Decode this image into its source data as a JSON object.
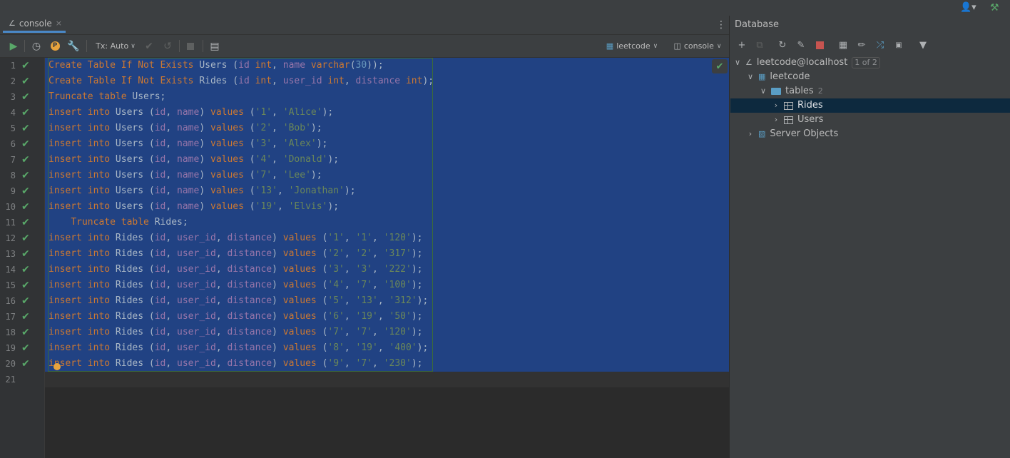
{
  "topbar": {
    "user_icon": "user-icon",
    "build_icon": "hammer-icon"
  },
  "tab": {
    "label": "console",
    "close": "×"
  },
  "toolbar": {
    "tx_label": "Tx: Auto",
    "datasource": "leetcode",
    "session": "console"
  },
  "editor": {
    "line_numbers": [
      "1",
      "2",
      "3",
      "4",
      "5",
      "6",
      "7",
      "8",
      "9",
      "10",
      "11",
      "12",
      "13",
      "14",
      "15",
      "16",
      "17",
      "18",
      "19",
      "20",
      "21"
    ],
    "lines": [
      [
        [
          "k",
          "Create Table If Not Exists "
        ],
        [
          "t",
          "Users ("
        ],
        [
          "f",
          "id"
        ],
        [
          "k",
          " int"
        ],
        [
          "t",
          ", "
        ],
        [
          "f",
          "name"
        ],
        [
          "k",
          " varchar"
        ],
        [
          "t",
          "("
        ],
        [
          "n",
          "30"
        ],
        [
          "t",
          "));"
        ]
      ],
      [
        [
          "k",
          "Create Table If Not Exists "
        ],
        [
          "t",
          "Rides ("
        ],
        [
          "f",
          "id"
        ],
        [
          "k",
          " int"
        ],
        [
          "t",
          ", "
        ],
        [
          "f",
          "user_id"
        ],
        [
          "k",
          " int"
        ],
        [
          "t",
          ", "
        ],
        [
          "f",
          "distance"
        ],
        [
          "k",
          " int"
        ],
        [
          "t",
          ");"
        ]
      ],
      [
        [
          "k",
          "Truncate table "
        ],
        [
          "t",
          "Users;"
        ]
      ],
      [
        [
          "k",
          "insert into "
        ],
        [
          "t",
          "Users ("
        ],
        [
          "f",
          "id"
        ],
        [
          "t",
          ", "
        ],
        [
          "f",
          "name"
        ],
        [
          "t",
          ") "
        ],
        [
          "k",
          "values "
        ],
        [
          "t",
          "("
        ],
        [
          "s",
          "'1'"
        ],
        [
          "t",
          ", "
        ],
        [
          "s",
          "'Alice'"
        ],
        [
          "t",
          ");"
        ]
      ],
      [
        [
          "k",
          "insert into "
        ],
        [
          "t",
          "Users ("
        ],
        [
          "f",
          "id"
        ],
        [
          "t",
          ", "
        ],
        [
          "f",
          "name"
        ],
        [
          "t",
          ") "
        ],
        [
          "k",
          "values "
        ],
        [
          "t",
          "("
        ],
        [
          "s",
          "'2'"
        ],
        [
          "t",
          ", "
        ],
        [
          "s",
          "'Bob'"
        ],
        [
          "t",
          ");"
        ]
      ],
      [
        [
          "k",
          "insert into "
        ],
        [
          "t",
          "Users ("
        ],
        [
          "f",
          "id"
        ],
        [
          "t",
          ", "
        ],
        [
          "f",
          "name"
        ],
        [
          "t",
          ") "
        ],
        [
          "k",
          "values "
        ],
        [
          "t",
          "("
        ],
        [
          "s",
          "'3'"
        ],
        [
          "t",
          ", "
        ],
        [
          "s",
          "'Alex'"
        ],
        [
          "t",
          ");"
        ]
      ],
      [
        [
          "k",
          "insert into "
        ],
        [
          "t",
          "Users ("
        ],
        [
          "f",
          "id"
        ],
        [
          "t",
          ", "
        ],
        [
          "f",
          "name"
        ],
        [
          "t",
          ") "
        ],
        [
          "k",
          "values "
        ],
        [
          "t",
          "("
        ],
        [
          "s",
          "'4'"
        ],
        [
          "t",
          ", "
        ],
        [
          "s",
          "'Donald'"
        ],
        [
          "t",
          ");"
        ]
      ],
      [
        [
          "k",
          "insert into "
        ],
        [
          "t",
          "Users ("
        ],
        [
          "f",
          "id"
        ],
        [
          "t",
          ", "
        ],
        [
          "f",
          "name"
        ],
        [
          "t",
          ") "
        ],
        [
          "k",
          "values "
        ],
        [
          "t",
          "("
        ],
        [
          "s",
          "'7'"
        ],
        [
          "t",
          ", "
        ],
        [
          "s",
          "'Lee'"
        ],
        [
          "t",
          ");"
        ]
      ],
      [
        [
          "k",
          "insert into "
        ],
        [
          "t",
          "Users ("
        ],
        [
          "f",
          "id"
        ],
        [
          "t",
          ", "
        ],
        [
          "f",
          "name"
        ],
        [
          "t",
          ") "
        ],
        [
          "k",
          "values "
        ],
        [
          "t",
          "("
        ],
        [
          "s",
          "'13'"
        ],
        [
          "t",
          ", "
        ],
        [
          "s",
          "'Jonathan'"
        ],
        [
          "t",
          ");"
        ]
      ],
      [
        [
          "k",
          "insert into "
        ],
        [
          "t",
          "Users ("
        ],
        [
          "f",
          "id"
        ],
        [
          "t",
          ", "
        ],
        [
          "f",
          "name"
        ],
        [
          "t",
          ") "
        ],
        [
          "k",
          "values "
        ],
        [
          "t",
          "("
        ],
        [
          "s",
          "'19'"
        ],
        [
          "t",
          ", "
        ],
        [
          "s",
          "'Elvis'"
        ],
        [
          "t",
          ");"
        ]
      ],
      [
        [
          "t",
          "    "
        ],
        [
          "k",
          "Truncate table "
        ],
        [
          "t",
          "Rides;"
        ]
      ],
      [
        [
          "k",
          "insert into "
        ],
        [
          "t",
          "Rides ("
        ],
        [
          "f",
          "id"
        ],
        [
          "t",
          ", "
        ],
        [
          "f",
          "user_id"
        ],
        [
          "t",
          ", "
        ],
        [
          "f",
          "distance"
        ],
        [
          "t",
          ") "
        ],
        [
          "k",
          "values "
        ],
        [
          "t",
          "("
        ],
        [
          "s",
          "'1'"
        ],
        [
          "t",
          ", "
        ],
        [
          "s",
          "'1'"
        ],
        [
          "t",
          ", "
        ],
        [
          "s",
          "'120'"
        ],
        [
          "t",
          ");"
        ]
      ],
      [
        [
          "k",
          "insert into "
        ],
        [
          "t",
          "Rides ("
        ],
        [
          "f",
          "id"
        ],
        [
          "t",
          ", "
        ],
        [
          "f",
          "user_id"
        ],
        [
          "t",
          ", "
        ],
        [
          "f",
          "distance"
        ],
        [
          "t",
          ") "
        ],
        [
          "k",
          "values "
        ],
        [
          "t",
          "("
        ],
        [
          "s",
          "'2'"
        ],
        [
          "t",
          ", "
        ],
        [
          "s",
          "'2'"
        ],
        [
          "t",
          ", "
        ],
        [
          "s",
          "'317'"
        ],
        [
          "t",
          ");"
        ]
      ],
      [
        [
          "k",
          "insert into "
        ],
        [
          "t",
          "Rides ("
        ],
        [
          "f",
          "id"
        ],
        [
          "t",
          ", "
        ],
        [
          "f",
          "user_id"
        ],
        [
          "t",
          ", "
        ],
        [
          "f",
          "distance"
        ],
        [
          "t",
          ") "
        ],
        [
          "k",
          "values "
        ],
        [
          "t",
          "("
        ],
        [
          "s",
          "'3'"
        ],
        [
          "t",
          ", "
        ],
        [
          "s",
          "'3'"
        ],
        [
          "t",
          ", "
        ],
        [
          "s",
          "'222'"
        ],
        [
          "t",
          ");"
        ]
      ],
      [
        [
          "k",
          "insert into "
        ],
        [
          "t",
          "Rides ("
        ],
        [
          "f",
          "id"
        ],
        [
          "t",
          ", "
        ],
        [
          "f",
          "user_id"
        ],
        [
          "t",
          ", "
        ],
        [
          "f",
          "distance"
        ],
        [
          "t",
          ") "
        ],
        [
          "k",
          "values "
        ],
        [
          "t",
          "("
        ],
        [
          "s",
          "'4'"
        ],
        [
          "t",
          ", "
        ],
        [
          "s",
          "'7'"
        ],
        [
          "t",
          ", "
        ],
        [
          "s",
          "'100'"
        ],
        [
          "t",
          ");"
        ]
      ],
      [
        [
          "k",
          "insert into "
        ],
        [
          "t",
          "Rides ("
        ],
        [
          "f",
          "id"
        ],
        [
          "t",
          ", "
        ],
        [
          "f",
          "user_id"
        ],
        [
          "t",
          ", "
        ],
        [
          "f",
          "distance"
        ],
        [
          "t",
          ") "
        ],
        [
          "k",
          "values "
        ],
        [
          "t",
          "("
        ],
        [
          "s",
          "'5'"
        ],
        [
          "t",
          ", "
        ],
        [
          "s",
          "'13'"
        ],
        [
          "t",
          ", "
        ],
        [
          "s",
          "'312'"
        ],
        [
          "t",
          ");"
        ]
      ],
      [
        [
          "k",
          "insert into "
        ],
        [
          "t",
          "Rides ("
        ],
        [
          "f",
          "id"
        ],
        [
          "t",
          ", "
        ],
        [
          "f",
          "user_id"
        ],
        [
          "t",
          ", "
        ],
        [
          "f",
          "distance"
        ],
        [
          "t",
          ") "
        ],
        [
          "k",
          "values "
        ],
        [
          "t",
          "("
        ],
        [
          "s",
          "'6'"
        ],
        [
          "t",
          ", "
        ],
        [
          "s",
          "'19'"
        ],
        [
          "t",
          ", "
        ],
        [
          "s",
          "'50'"
        ],
        [
          "t",
          ");"
        ]
      ],
      [
        [
          "k",
          "insert into "
        ],
        [
          "t",
          "Rides ("
        ],
        [
          "f",
          "id"
        ],
        [
          "t",
          ", "
        ],
        [
          "f",
          "user_id"
        ],
        [
          "t",
          ", "
        ],
        [
          "f",
          "distance"
        ],
        [
          "t",
          ") "
        ],
        [
          "k",
          "values "
        ],
        [
          "t",
          "("
        ],
        [
          "s",
          "'7'"
        ],
        [
          "t",
          ", "
        ],
        [
          "s",
          "'7'"
        ],
        [
          "t",
          ", "
        ],
        [
          "s",
          "'120'"
        ],
        [
          "t",
          ");"
        ]
      ],
      [
        [
          "k",
          "insert into "
        ],
        [
          "t",
          "Rides ("
        ],
        [
          "f",
          "id"
        ],
        [
          "t",
          ", "
        ],
        [
          "f",
          "user_id"
        ],
        [
          "t",
          ", "
        ],
        [
          "f",
          "distance"
        ],
        [
          "t",
          ") "
        ],
        [
          "k",
          "values "
        ],
        [
          "t",
          "("
        ],
        [
          "s",
          "'8'"
        ],
        [
          "t",
          ", "
        ],
        [
          "s",
          "'19'"
        ],
        [
          "t",
          ", "
        ],
        [
          "s",
          "'400'"
        ],
        [
          "t",
          ");"
        ]
      ],
      [
        [
          "k",
          "insert into "
        ],
        [
          "t",
          "Rides ("
        ],
        [
          "f",
          "id"
        ],
        [
          "t",
          ", "
        ],
        [
          "f",
          "user_id"
        ],
        [
          "t",
          ", "
        ],
        [
          "f",
          "distance"
        ],
        [
          "t",
          ") "
        ],
        [
          "k",
          "values "
        ],
        [
          "t",
          "("
        ],
        [
          "s",
          "'9'"
        ],
        [
          "t",
          ", "
        ],
        [
          "s",
          "'7'"
        ],
        [
          "t",
          ", "
        ],
        [
          "s",
          "'230'"
        ],
        [
          "t",
          ");"
        ]
      ],
      []
    ]
  },
  "database": {
    "title": "Database",
    "connection": "leetcode@localhost",
    "connection_badge": "1 of 2",
    "schema": "leetcode",
    "tables_folder": "tables",
    "tables_count": "2",
    "tables": [
      "Rides",
      "Users"
    ],
    "server_objects": "Server Objects"
  },
  "colors": {
    "selection": "#214283",
    "keyword": "#cc7832",
    "field": "#9876aa",
    "string": "#6a8759",
    "number": "#6897bb",
    "success": "#59a869"
  }
}
